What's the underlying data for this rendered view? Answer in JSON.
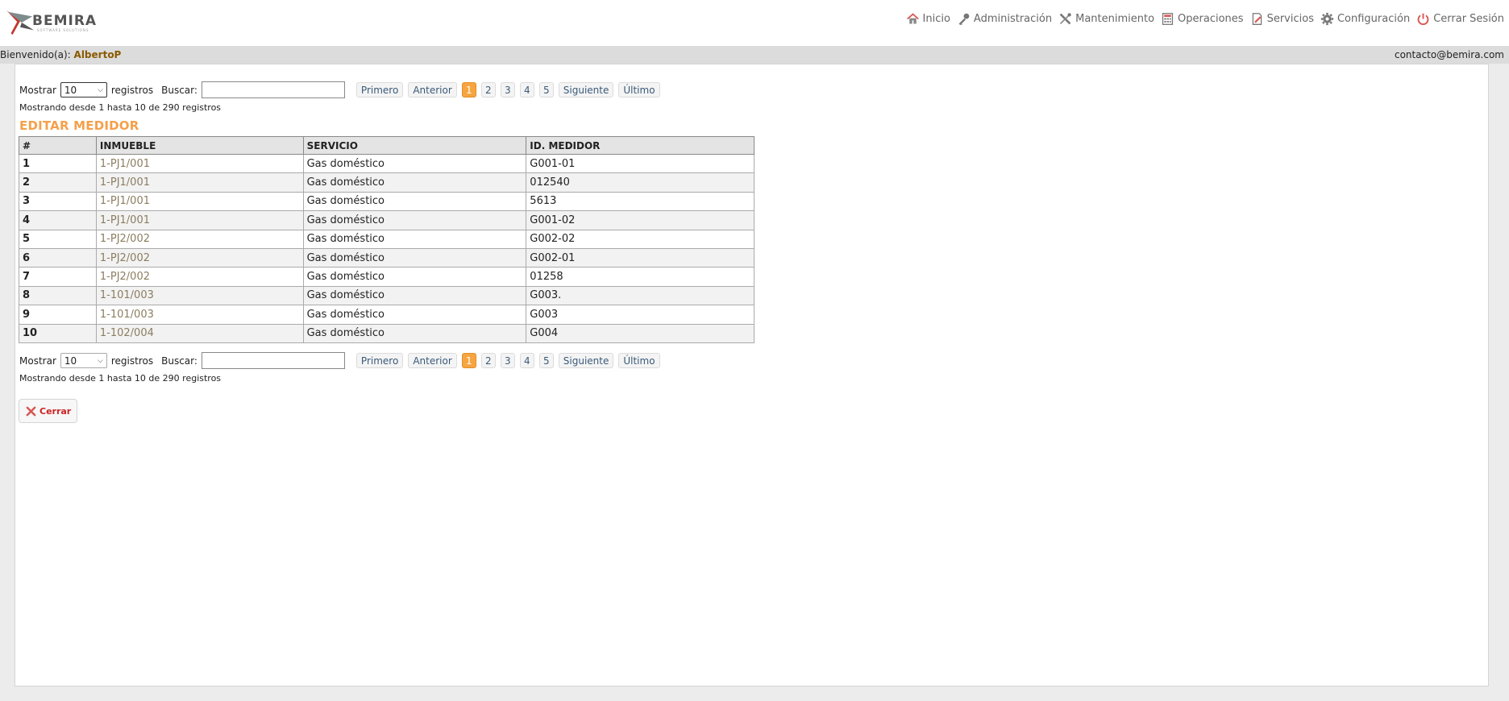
{
  "header": {
    "logo_text": "BEMIRA",
    "logo_subtext": "SOFTWARE SOLUTIONS",
    "nav": [
      {
        "label": "Inicio",
        "icon": "home-icon"
      },
      {
        "label": "Administración",
        "icon": "key-icon"
      },
      {
        "label": "Mantenimiento",
        "icon": "tools-icon"
      },
      {
        "label": "Operaciones",
        "icon": "calculator-icon"
      },
      {
        "label": "Servicios",
        "icon": "edit-document-icon"
      },
      {
        "label": "Configuración",
        "icon": "gear-icon"
      },
      {
        "label": "Cerrar Sesión",
        "icon": "power-icon"
      }
    ]
  },
  "welcome": {
    "prefix": "Bienvenido(a):",
    "user": "AlbertoP",
    "contact": "contacto@bemira.com"
  },
  "controls": {
    "show_label": "Mostrar",
    "page_size": "10",
    "records_label": "registros",
    "search_label": "Buscar:",
    "search_value": "",
    "first": "Primero",
    "previous": "Anterior",
    "pages": [
      "1",
      "2",
      "3",
      "4",
      "5"
    ],
    "active_page": "1",
    "next": "Siguiente",
    "last": "Último",
    "info": "Mostrando desde 1 hasta 10 de 290 registros"
  },
  "section_title": "EDITAR MEDIDOR",
  "table": {
    "columns": [
      "#",
      "INMUEBLE",
      "SERVICIO",
      "ID. MEDIDOR"
    ],
    "rows": [
      [
        "1",
        "1-PJ1/001",
        "Gas doméstico",
        "G001-01"
      ],
      [
        "2",
        "1-PJ1/001",
        "Gas doméstico",
        "012540"
      ],
      [
        "3",
        "1-PJ1/001",
        "Gas doméstico",
        "5613"
      ],
      [
        "4",
        "1-PJ1/001",
        "Gas doméstico",
        "G001-02"
      ],
      [
        "5",
        "1-PJ2/002",
        "Gas doméstico",
        "G002-02"
      ],
      [
        "6",
        "1-PJ2/002",
        "Gas doméstico",
        "G002-01"
      ],
      [
        "7",
        "1-PJ2/002",
        "Gas doméstico",
        "01258"
      ],
      [
        "8",
        "1-101/003",
        "Gas doméstico",
        "G003."
      ],
      [
        "9",
        "1-101/003",
        "Gas doméstico",
        "G003"
      ],
      [
        "10",
        "1-102/004",
        "Gas doméstico",
        "G004"
      ]
    ]
  },
  "close_button": "Cerrar",
  "colors": {
    "accent": "#f7a540",
    "title": "#f4a04a",
    "close": "#cc2222",
    "user": "#8a5a00"
  }
}
